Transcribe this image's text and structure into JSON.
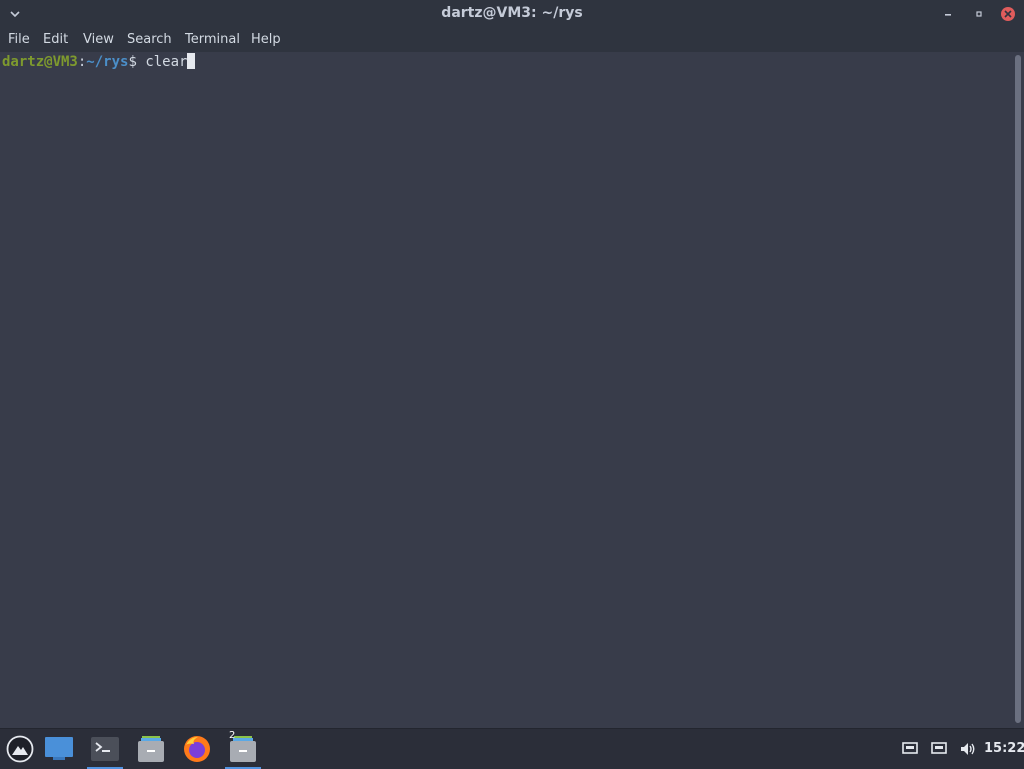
{
  "window": {
    "title": "dartz@VM3: ~/rys",
    "controls": {
      "menu_icon": "chevron-down-icon",
      "minimize_icon": "minimize-icon",
      "maximize_icon": "maximize-icon",
      "close_icon": "close-icon"
    }
  },
  "menubar": {
    "items": [
      "File",
      "Edit",
      "View",
      "Search",
      "Terminal",
      "Help"
    ]
  },
  "terminal": {
    "prompt_user_host": "dartz@VM3",
    "prompt_colon": ":",
    "prompt_path": "~/rys",
    "prompt_dollar": "$",
    "command": " clear"
  },
  "taskbar": {
    "items": [
      {
        "name": "app-menu-icon"
      },
      {
        "name": "desktop-icon"
      },
      {
        "name": "terminal-icon"
      },
      {
        "name": "file-manager-icon"
      },
      {
        "name": "firefox-icon"
      },
      {
        "name": "file-manager-group-icon",
        "badge": "2"
      }
    ],
    "tray": [
      "network-icon",
      "network-wired-icon",
      "volume-icon"
    ],
    "clock": "15:22"
  },
  "colors": {
    "terminal_bg": "#383c4a",
    "titlebar_bg": "#2f343f",
    "prompt_user": "#7e9a2e",
    "prompt_path": "#4b8fc9",
    "close_button": "#e05c5c",
    "taskbar_bg": "#2b2e39",
    "accent": "#5294e2"
  }
}
